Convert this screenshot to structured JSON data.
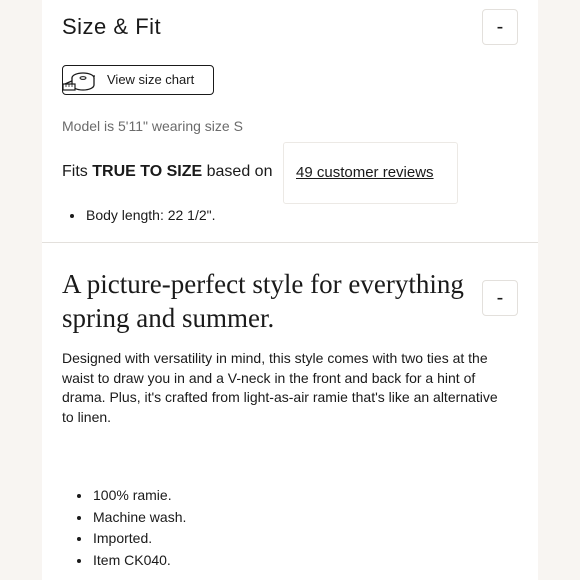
{
  "size_fit": {
    "title": "Size & Fit",
    "collapse_symbol": "-",
    "size_chart_label": "View size chart",
    "size_chart_icon": "measuring-tape-icon",
    "model_note": "Model is 5'11\" wearing size S",
    "fits_prefix": "Fits",
    "fits_emphasis": "TRUE TO SIZE",
    "fits_suffix": "based on",
    "reviews_link": "49 customer reviews",
    "measurements": [
      "Body length: 22 1/2\"."
    ]
  },
  "details": {
    "title": "A picture-perfect style for everything spring and summer.",
    "collapse_symbol": "-",
    "description": "Designed with versatility in mind, this style comes with two ties at the waist to draw you in and a V-neck in the front and back for a hint of drama. Plus, it's crafted from light-as-air ramie that's like an alternative to linen.",
    "features": [
      "100% ramie.",
      "Machine wash.",
      "Imported.",
      "Item CK040."
    ]
  }
}
